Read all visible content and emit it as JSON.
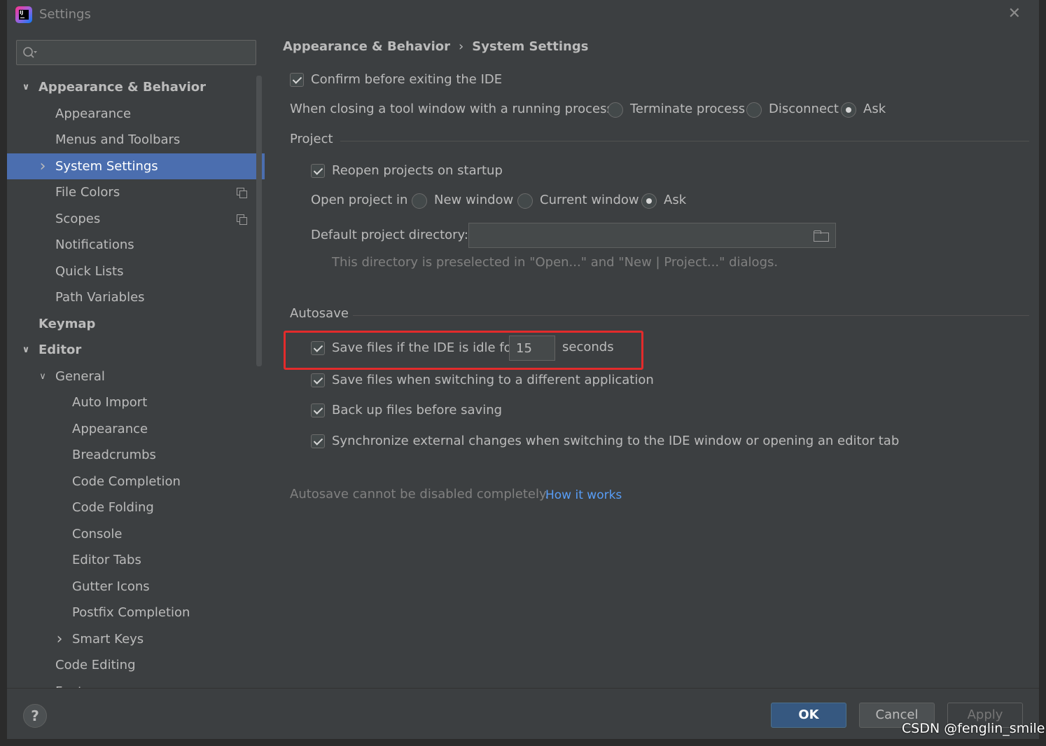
{
  "window": {
    "title": "Settings",
    "close_glyph": "✕",
    "app_icon": "intellij-idea-icon",
    "app_icon_text": "IJ"
  },
  "sidebar": {
    "search_placeholder": "",
    "items": [
      {
        "label": "Appearance & Behavior",
        "level": 0,
        "expanded": true,
        "bold": true
      },
      {
        "label": "Appearance",
        "level": 1
      },
      {
        "label": "Menus and Toolbars",
        "level": 1
      },
      {
        "label": "System Settings",
        "level": 1,
        "collapsed": true,
        "selected": true
      },
      {
        "label": "File Colors",
        "level": 1,
        "copy_icon": true
      },
      {
        "label": "Scopes",
        "level": 1,
        "copy_icon": true
      },
      {
        "label": "Notifications",
        "level": 1
      },
      {
        "label": "Quick Lists",
        "level": 1
      },
      {
        "label": "Path Variables",
        "level": 1
      },
      {
        "label": "Keymap",
        "level": 0,
        "bold": true
      },
      {
        "label": "Editor",
        "level": 0,
        "expanded": true,
        "bold": true
      },
      {
        "label": "General",
        "level": 1,
        "expanded": true
      },
      {
        "label": "Auto Import",
        "level": 2
      },
      {
        "label": "Appearance",
        "level": 2
      },
      {
        "label": "Breadcrumbs",
        "level": 2
      },
      {
        "label": "Code Completion",
        "level": 2
      },
      {
        "label": "Code Folding",
        "level": 2
      },
      {
        "label": "Console",
        "level": 2
      },
      {
        "label": "Editor Tabs",
        "level": 2
      },
      {
        "label": "Gutter Icons",
        "level": 2
      },
      {
        "label": "Postfix Completion",
        "level": 2
      },
      {
        "label": "Smart Keys",
        "level": 2,
        "collapsed": true
      },
      {
        "label": "Code Editing",
        "level": 1
      },
      {
        "label": "Font",
        "level": 1
      }
    ]
  },
  "content": {
    "breadcrumb": {
      "parent": "Appearance & Behavior",
      "separator": "›",
      "current": "System Settings"
    },
    "confirm_exit": {
      "label": "Confirm before exiting the IDE",
      "checked": true
    },
    "tool_window": {
      "label": "When closing a tool window with a running process:",
      "options": [
        "Terminate process",
        "Disconnect",
        "Ask"
      ],
      "selected": "Ask"
    },
    "project": {
      "section_title": "Project",
      "reopen": {
        "label": "Reopen projects on startup",
        "checked": true
      },
      "open_in": {
        "label": "Open project in",
        "options": [
          "New window",
          "Current window",
          "Ask"
        ],
        "selected": "Ask"
      },
      "default_dir": {
        "label": "Default project directory:",
        "value": ""
      },
      "hint": "This directory is preselected in \"Open...\" and \"New | Project...\" dialogs."
    },
    "autosave": {
      "section_title": "Autosave",
      "idle": {
        "label": "Save files if the IDE is idle for",
        "value": "15",
        "suffix": "seconds",
        "checked": true,
        "highlight_color": "#e32b2b"
      },
      "switching": {
        "label": "Save files when switching to a different application",
        "checked": true
      },
      "backup": {
        "label": "Back up files before saving",
        "checked": true
      },
      "sync": {
        "label": "Synchronize external changes when switching to the IDE window or opening an editor tab",
        "checked": true
      },
      "note": "Autosave cannot be disabled completely.",
      "link": "How it works"
    }
  },
  "footer": {
    "help": "?",
    "ok": "OK",
    "cancel": "Cancel",
    "apply": "Apply"
  },
  "watermark": "CSDN @fenglin_smile",
  "colors": {
    "selected": "#4b6eaf",
    "ok_button": "#365880",
    "link": "#589df6",
    "background": "#3c3f41"
  }
}
